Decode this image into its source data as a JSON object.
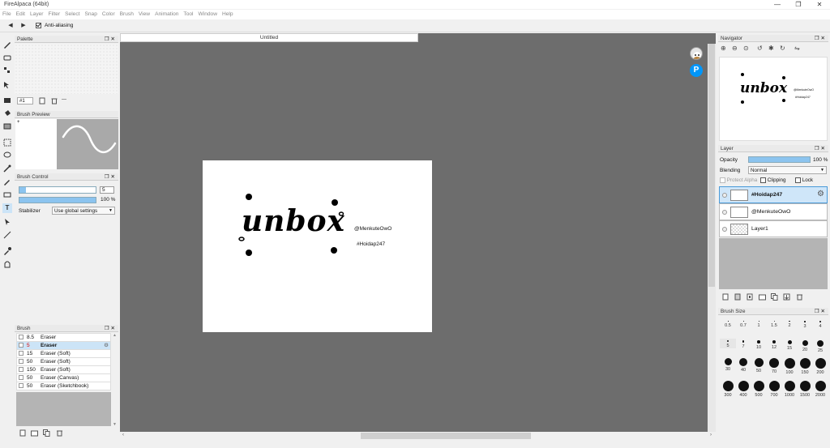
{
  "window": {
    "title": "FireAlpaca (64bit)",
    "controls": [
      "—",
      "❐",
      "✕"
    ]
  },
  "menu": [
    "File",
    "Edit",
    "Layer",
    "Filter",
    "Select",
    "Snap",
    "Color",
    "Brush",
    "View",
    "Animation",
    "Tool",
    "Window",
    "Help"
  ],
  "toolbar": {
    "anti_aliasing_label": "Anti-aliasing",
    "anti_aliasing_checked": true
  },
  "palette": {
    "title": "Palette",
    "selector": "#1",
    "more": "---"
  },
  "brush_preview": {
    "title": "Brush Preview"
  },
  "brush_control": {
    "title": "Brush Control",
    "size_value": "5",
    "opacity_percent": 100,
    "opacity_label": "100 %",
    "stabilizer_label": "Stabilizer",
    "stabilizer_value": "Use global settings"
  },
  "brush_list": {
    "title": "Brush",
    "items": [
      {
        "size": "8.5",
        "name": "Eraser",
        "selected": false
      },
      {
        "size": "5",
        "name": "Eraser",
        "selected": true
      },
      {
        "size": "15",
        "name": "Eraser (Soft)",
        "selected": false
      },
      {
        "size": "50",
        "name": "Eraser (Soft)",
        "selected": false
      },
      {
        "size": "150",
        "name": "Eraser (Soft)",
        "selected": false
      },
      {
        "size": "50",
        "name": "Eraser (Canvas)",
        "selected": false
      },
      {
        "size": "50",
        "name": "Eraser (Sketchbook)",
        "selected": false
      }
    ]
  },
  "document": {
    "tab_title": "Untitled",
    "canvas_text": {
      "main": "unbox",
      "credit1": "@MenkuteOwO",
      "credit2": "#Hoidap247"
    }
  },
  "navigator": {
    "title": "Navigator",
    "preview_main": "unbox",
    "preview_credit1": "@MenkuteOwO",
    "preview_credit2": "#Hoidap247"
  },
  "layer": {
    "title": "Layer",
    "opacity_label": "Opacity",
    "opacity_percent": 100,
    "opacity_value": "100 %",
    "blending_label": "Blending",
    "blending_value": "Normal",
    "protect_alpha": "Protect Alpha",
    "clipping": "Clipping",
    "lock": "Lock",
    "layers": [
      {
        "name": "#Hoidap247",
        "selected": true
      },
      {
        "name": "@MenkuteOwO",
        "selected": false
      },
      {
        "name": "Layer1",
        "selected": false
      }
    ]
  },
  "brush_size": {
    "title": "Brush Size",
    "sizes": [
      "0.5",
      "0.7",
      "1",
      "1.5",
      "2",
      "3",
      "4",
      "5",
      "7",
      "10",
      "12",
      "15",
      "20",
      "25",
      "30",
      "40",
      "50",
      "70",
      "100",
      "150",
      "200",
      "300",
      "400",
      "500",
      "700",
      "1000",
      "1500",
      "2000"
    ]
  },
  "colors": {
    "canvas_bg": "#6d6d6d",
    "selection": "#cce4f7",
    "accent": "#4a9ad8"
  }
}
